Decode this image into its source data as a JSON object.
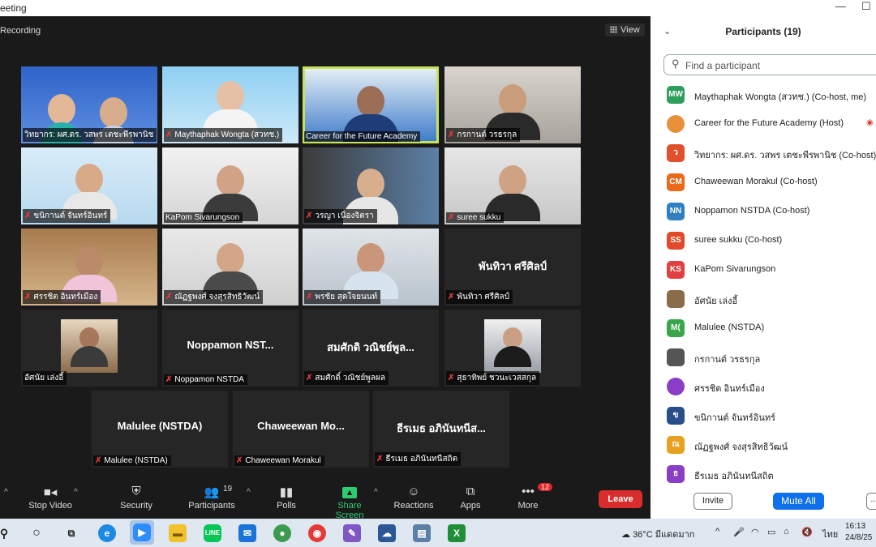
{
  "window": {
    "title": "eeting",
    "min": "—",
    "max": "☐"
  },
  "meeting": {
    "recording_label": "Recording",
    "view_label": "View"
  },
  "tiles": [
    {
      "label": "วิทยากร: ผศ.ดร. วสพร เตชะพีรพานิช",
      "big": ""
    },
    {
      "label": "Maythaphak Wongta (สวทช.)",
      "big": ""
    },
    {
      "label": "Career for the Future Academy",
      "big": ""
    },
    {
      "label": "กรกานต์ วรธรกุล",
      "big": ""
    },
    {
      "label": "ขนิกานต์ จันทร์อินทร์",
      "big": ""
    },
    {
      "label": "KaPom Sivarungson",
      "big": ""
    },
    {
      "label": "วรญา เนื่องจิตรา",
      "big": ""
    },
    {
      "label": "suree sukku",
      "big": ""
    },
    {
      "label": "ศรรชิต อินทร์เมือง",
      "big": ""
    },
    {
      "label": "ณัฏฐพงศ์ จงสุรสิทธิวัฒน์",
      "big": ""
    },
    {
      "label": "พรชัย สุดใจยนนท์",
      "big": ""
    },
    {
      "label": "พันทิวา ศรีศิลป์",
      "big": "พันทิวา ศรีศิลป์"
    },
    {
      "label": "อัศนัย เล่งอี้",
      "big": ""
    },
    {
      "label": "Noppamon NSTDA",
      "big": "Noppamon NST..."
    },
    {
      "label": "สมศักดิ์ วณิชย์พูลผล",
      "big": "สมศักดิ วณิชย์พูล..."
    },
    {
      "label": "สุธาทิพย์ ชวนะเวสสกุล",
      "big": ""
    },
    {
      "label": "Malulee (NSTDA)",
      "big": "Malulee (NSTDA)"
    },
    {
      "label": "Chaweewan Morakul",
      "big": "Chaweewan Mo..."
    },
    {
      "label": "ธีรเมธ อภินันทนีสถิต",
      "big": "ธีรเมธ อภินันทนีส..."
    }
  ],
  "toolbar": {
    "stop_video": "Stop Video",
    "security": "Security",
    "participants": "Participants",
    "participants_count": "19",
    "polls": "Polls",
    "share_screen": "Share Screen",
    "reactions": "Reactions",
    "apps": "Apps",
    "more": "More",
    "more_badge": "12",
    "leave": "Leave"
  },
  "panel": {
    "title": "Participants (19)",
    "search_placeholder": "Find a participant",
    "invite": "Invite",
    "mute_all": "Mute All",
    "more": "...",
    "participants": [
      {
        "initials": "MW",
        "name": "Maythaphak Wongta (สวทช.) (Co-host, me)",
        "color": "#2e9e5b"
      },
      {
        "initials": "",
        "name": "Career for the Future Academy (Host)",
        "color": "#e8903a"
      },
      {
        "initials": "ว",
        "name": "วิทยากร: ผศ.ดร. วสพร เตชะพีรพานิช (Co-host)",
        "color": "#e0502a"
      },
      {
        "initials": "CM",
        "name": "Chaweewan Morakul (Co-host)",
        "color": "#e86a1a"
      },
      {
        "initials": "NN",
        "name": "Noppamon NSTDA (Co-host)",
        "color": "#2f7fc1"
      },
      {
        "initials": "SS",
        "name": "suree sukku (Co-host)",
        "color": "#e04a2a"
      },
      {
        "initials": "KS",
        "name": "KaPom Sivarungson",
        "color": "#e04040"
      },
      {
        "initials": "",
        "name": "อัศนัย เล่งอี้",
        "color": "#8a6b4a"
      },
      {
        "initials": "M(",
        "name": "Malulee (NSTDA)",
        "color": "#3aa64a"
      },
      {
        "initials": "",
        "name": "กรกานต์ วรธรกุล",
        "color": "#555555"
      },
      {
        "initials": "",
        "name": "ศรรชิต อินทร์เมือง",
        "color": "#8a3ec8"
      },
      {
        "initials": "ข",
        "name": "ขนิกานต์ จันทร์อินทร์",
        "color": "#2a4e8a"
      },
      {
        "initials": "ณ",
        "name": "ณัฏฐพงศ์ จงสุรสิทธิวัฒน์",
        "color": "#e8a020"
      },
      {
        "initials": "ธ",
        "name": "ธีรเมธ อภินันทนีสถิต",
        "color": "#8a3ec8"
      }
    ]
  },
  "taskbar": {
    "temperature": "36°C",
    "weather_text": "มีแดดมาก",
    "lang": "ไทย",
    "time": "16:13",
    "date": "24/8/25"
  }
}
